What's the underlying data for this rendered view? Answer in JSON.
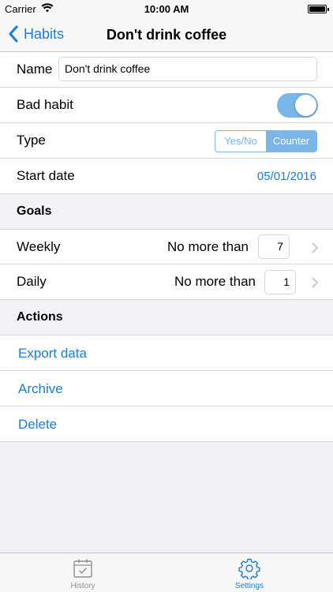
{
  "status_bar": {
    "carrier": "Carrier",
    "time": "10:00 AM"
  },
  "nav": {
    "back_label": "Habits",
    "title": "Don't drink coffee"
  },
  "form": {
    "name_label": "Name",
    "name_value": "Don't drink coffee",
    "bad_habit_label": "Bad habit",
    "bad_habit_on": true,
    "type_label": "Type",
    "type_options": [
      "Yes/No",
      "Counter"
    ],
    "type_selected": "Counter",
    "start_date_label": "Start date",
    "start_date_value": "05/01/2016"
  },
  "goals": {
    "header": "Goals",
    "weekly": {
      "label": "Weekly",
      "qualifier": "No more than",
      "value": "7"
    },
    "daily": {
      "label": "Daily",
      "qualifier": "No more than",
      "value": "1"
    }
  },
  "actions": {
    "header": "Actions",
    "items": [
      "Export data",
      "Archive",
      "Delete"
    ]
  },
  "tabs": [
    {
      "label": "History",
      "icon": "calendar-check-icon",
      "active": false
    },
    {
      "label": "Settings",
      "icon": "gear-icon",
      "active": true
    }
  ],
  "colors": {
    "accent": "#1a7ed6",
    "toggle": "#7ab6ea",
    "background": "#efeff4"
  }
}
